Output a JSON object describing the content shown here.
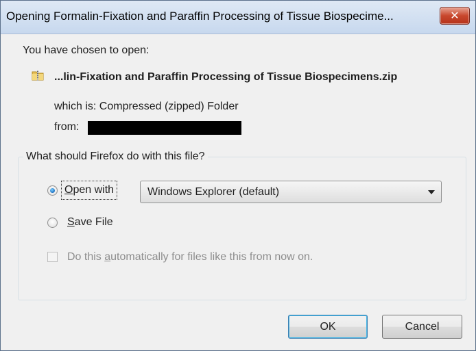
{
  "window": {
    "title": "Opening Formalin-Fixation and Paraffin Processing of Tissue Biospecime...",
    "close_icon": "close-x"
  },
  "intro_text": "You have chosen to open:",
  "file": {
    "icon": "zipped-folder-icon",
    "name": "...lin-Fixation and Paraffin Processing of Tissue Biospecimens.zip",
    "type_text": "which is: Compressed (zipped) Folder",
    "from_label": "from:"
  },
  "action_group": {
    "label": "What should Firefox do with this file?",
    "open_with": {
      "mnemonic": "O",
      "rest": "pen with",
      "checked": true
    },
    "app_select": {
      "value": "Windows Explorer (default)"
    },
    "save_file": {
      "mnemonic": "S",
      "rest": "ave File",
      "checked": false
    },
    "auto": {
      "before": "Do this ",
      "mnemonic": "a",
      "after": "utomatically for files like this from now on.",
      "checked": false,
      "enabled": false
    }
  },
  "buttons": {
    "ok": "OK",
    "cancel": "Cancel"
  },
  "colors": {
    "titlebar": "#c7d8ee",
    "close": "#c8472d",
    "dialog_bg": "#f0f0f0",
    "default_button_border": "#3c7fb1",
    "disabled_text": "#8d8d8d"
  }
}
